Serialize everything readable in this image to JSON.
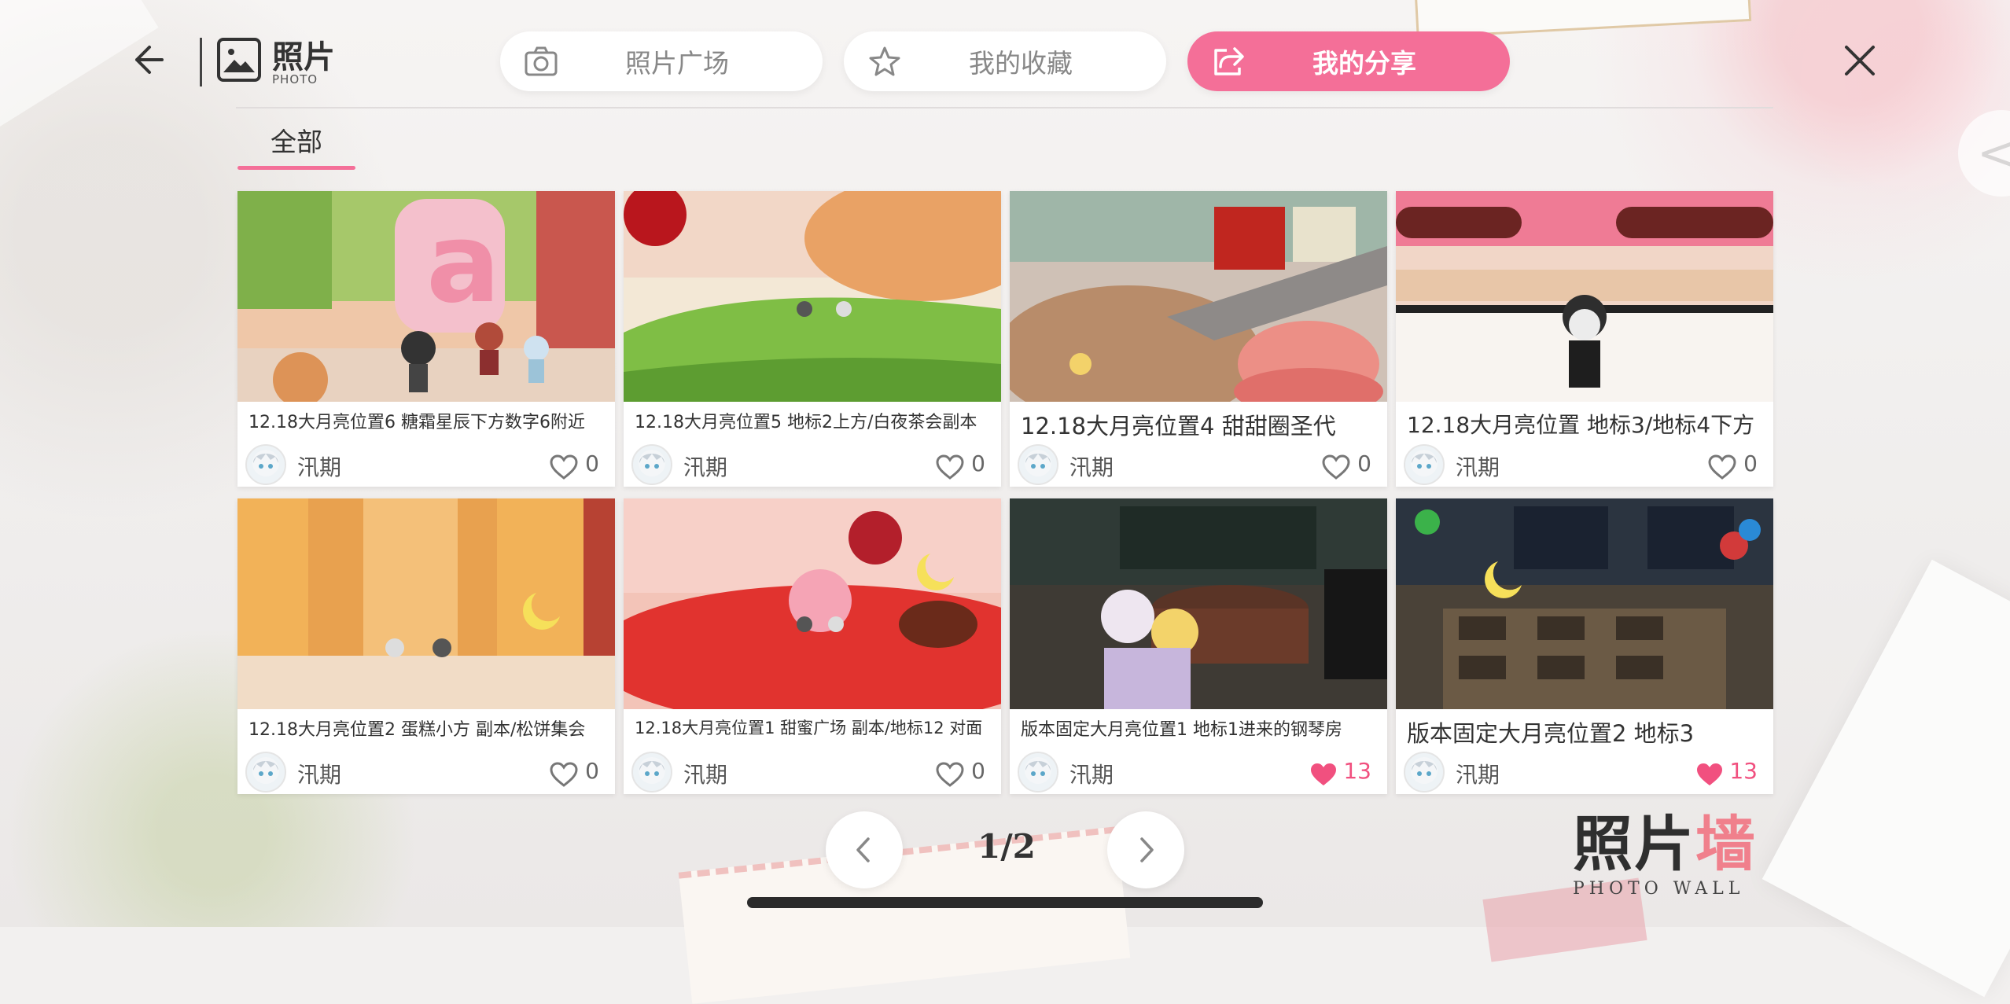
{
  "header": {
    "title": "照片",
    "subtitle": "PHOTO",
    "tabs": [
      {
        "label": "照片广场",
        "icon": "camera-icon",
        "active": false
      },
      {
        "label": "我的收藏",
        "icon": "star-icon",
        "active": false
      },
      {
        "label": "我的分享",
        "icon": "share-icon",
        "active": true
      }
    ]
  },
  "categories": {
    "active": "全部"
  },
  "photos": [
    {
      "caption": "12.18大月亮位置6 糖霜星辰下方数字6附近",
      "author": "汛期",
      "likes": "0",
      "liked": false
    },
    {
      "caption": "12.18大月亮位置5 地标2上方/白夜茶会副本",
      "author": "汛期",
      "likes": "0",
      "liked": false
    },
    {
      "caption": "12.18大月亮位置4 甜甜圈圣代",
      "author": "汛期",
      "likes": "0",
      "liked": false
    },
    {
      "caption": "12.18大月亮位置 地标3/地标4下方",
      "author": "汛期",
      "likes": "0",
      "liked": false
    },
    {
      "caption": "12.18大月亮位置2 蛋糕小方 副本/松饼集会",
      "author": "汛期",
      "likes": "0",
      "liked": false
    },
    {
      "caption": "12.18大月亮位置1 甜蜜广场 副本/地标12 对面",
      "author": "汛期",
      "likes": "0",
      "liked": false
    },
    {
      "caption": "版本固定大月亮位置1 地标1进来的钢琴房",
      "author": "汛期",
      "likes": "13",
      "liked": true
    },
    {
      "caption": "版本固定大月亮位置2 地标3",
      "author": "汛期",
      "likes": "13",
      "liked": true
    }
  ],
  "pagination": {
    "current": "1/2"
  },
  "watermark": {
    "title_main": "照片",
    "title_accent": "墙",
    "subtitle": "PHOTO WALL"
  },
  "colors": {
    "accent": "#f46f98",
    "liked": "#f1507f"
  }
}
